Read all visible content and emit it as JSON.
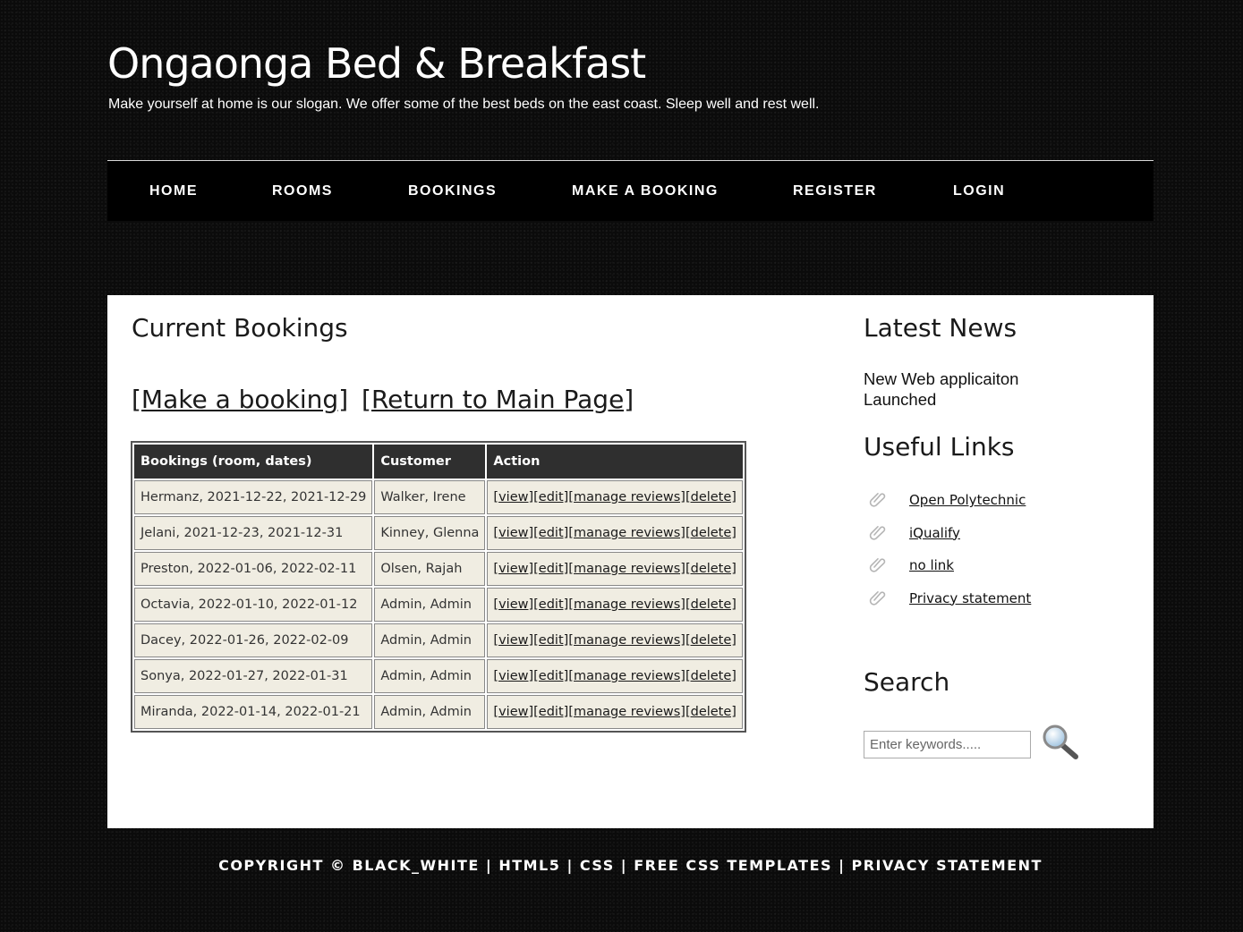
{
  "header": {
    "site_title": "Ongaonga Bed & Breakfast",
    "slogan": "Make yourself at home is our slogan. We offer some of the best beds on the east coast. Sleep well and rest well."
  },
  "nav": {
    "items": [
      {
        "label": "HOME"
      },
      {
        "label": "ROOMS"
      },
      {
        "label": "BOOKINGS"
      },
      {
        "label": "MAKE A BOOKING"
      },
      {
        "label": "REGISTER"
      },
      {
        "label": "LOGIN"
      }
    ]
  },
  "main": {
    "title": "Current Bookings",
    "make_booking_link": "[Make a booking]",
    "return_link": "[Return to Main Page]",
    "table": {
      "headers": [
        "Bookings (room, dates)",
        "Customer",
        "Action"
      ],
      "action_labels": {
        "view": "[view]",
        "edit": "[edit]",
        "manage_reviews": "[manage reviews]",
        "delete": "[delete]"
      },
      "rows": [
        {
          "booking": "Hermanz, 2021-12-22, 2021-12-29",
          "customer": "Walker, Irene"
        },
        {
          "booking": "Jelani, 2021-12-23, 2021-12-31",
          "customer": "Kinney, Glenna"
        },
        {
          "booking": "Preston, 2022-01-06, 2022-02-11",
          "customer": "Olsen, Rajah"
        },
        {
          "booking": "Octavia, 2022-01-10, 2022-01-12",
          "customer": "Admin, Admin"
        },
        {
          "booking": "Dacey, 2022-01-26, 2022-02-09",
          "customer": "Admin, Admin"
        },
        {
          "booking": "Sonya, 2022-01-27, 2022-01-31",
          "customer": "Admin, Admin"
        },
        {
          "booking": "Miranda, 2022-01-14, 2022-01-21",
          "customer": "Admin, Admin"
        }
      ]
    }
  },
  "sidebar": {
    "news_title": "Latest News",
    "news_item": "New Web applicaiton Launched",
    "links_title": "Useful Links",
    "links": [
      {
        "label": "Open Polytechnic",
        "icon": "paperclip-icon"
      },
      {
        "label": "iQualify",
        "icon": "paperclip-icon"
      },
      {
        "label": "no link",
        "icon": "paperclip-icon"
      },
      {
        "label": "Privacy statement",
        "icon": "paperclip-icon"
      }
    ],
    "search_title": "Search",
    "search_placeholder": "Enter keywords.....",
    "search_icon": "magnifier-icon"
  },
  "footer": {
    "text": "COPYRIGHT © BLACK_WHITE | HTML5 | CSS | FREE CSS TEMPLATES | PRIVACY STATEMENT"
  },
  "colors": {
    "page_background": "#0b0b0b",
    "nav_background": "#000000",
    "table_header": "#2f2f2f",
    "table_cell": "#f0ede2"
  }
}
